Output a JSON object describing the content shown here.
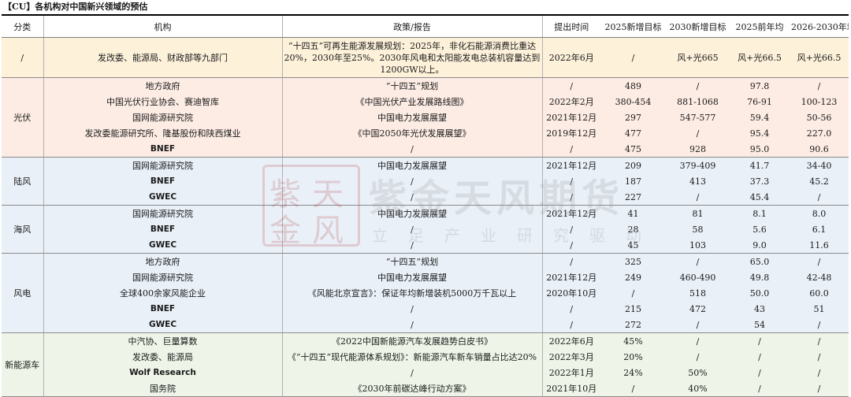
{
  "title": "【CU】各机构对中国新兴领域的预估",
  "headers": [
    "分类",
    "机构",
    "政策/报告",
    "提出时间",
    "2025新增目标",
    "2030新增目标",
    "2025前年均",
    "2026-2030年均"
  ],
  "groups": [
    {
      "category": "/",
      "rows": [
        [
          "发改委、能源局、财政部等九部门",
          "“十四五”可再生能源发展规划：2025年，非化石能源消费比重达20%，2030年至25%。2030年风电和太阳能发电总装机容量达到1200GW以上。",
          "2022年6月",
          "/",
          "风+光665",
          "风+光66.5",
          "风+光66.5"
        ]
      ]
    },
    {
      "category": "光伏",
      "rows": [
        [
          "地方政府",
          "“十四五”规划",
          "/",
          "489",
          "/",
          "97.8",
          "/"
        ],
        [
          "中国光伏行业协会、赛迪智库",
          "《中国光伏产业发展路线图》",
          "2022年2月",
          "380-454",
          "881-1068",
          "76-91",
          "100-123"
        ],
        [
          "国网能源研究院",
          "中国电力发展展望",
          "2021年12月",
          "297",
          "547-577",
          "59.4",
          "50-56"
        ],
        [
          "发改委能源研究所、隆基股份和陕西煤业",
          "《中国2050年光伏发展展望》",
          "2019年12月",
          "477",
          "/",
          "95.4",
          "227.0"
        ],
        [
          "BNEF",
          "/",
          "/",
          "475",
          "928",
          "95.0",
          "90.6"
        ]
      ]
    },
    {
      "category": "陆风",
      "rows": [
        [
          "国网能源研究院",
          "中国电力发展展望",
          "2021年12月",
          "209",
          "379-409",
          "41.7",
          "34-40"
        ],
        [
          "BNEF",
          "/",
          "/",
          "187",
          "413",
          "37.3",
          "45.2"
        ],
        [
          "GWEC",
          "/",
          "/",
          "227",
          "/",
          "45.4",
          "/"
        ]
      ]
    },
    {
      "category": "海风",
      "rows": [
        [
          "国网能源研究院",
          "中国电力发展展望",
          "2021年12月",
          "41",
          "81",
          "8.1",
          "8.0"
        ],
        [
          "BNEF",
          "/",
          "/",
          "28",
          "58",
          "5.6",
          "6.1"
        ],
        [
          "GWEC",
          "/",
          "/",
          "45",
          "103",
          "9.0",
          "11.6"
        ]
      ]
    },
    {
      "category": "风电",
      "rows": [
        [
          "地方政府",
          "“十四五”规划",
          "/",
          "325",
          "/",
          "65.0",
          "/"
        ],
        [
          "国网能源研究院",
          "中国电力发展展望",
          "2021年12月",
          "249",
          "460-490",
          "49.8",
          "42-48"
        ],
        [
          "全球400余家风能企业",
          "《风能北京宣言》：保证年均新增装机5000万千瓦以上",
          "2020年10月",
          "/",
          "518",
          "50.0",
          "60.0"
        ],
        [
          "BNEF",
          "/",
          "/",
          "215",
          "472",
          "43",
          "51"
        ],
        [
          "GWEC",
          "/",
          "/",
          "272",
          "/",
          "54",
          "/"
        ]
      ]
    },
    {
      "category": "新能源车",
      "rows": [
        [
          "中汽协、巨量算数",
          "《2022中国新能源汽车发展趋势白皮书》",
          "2022年6月",
          "45%",
          "/",
          "/",
          "/"
        ],
        [
          "发改委、能源局",
          "《“十四五”现代能源体系规划》：新能源汽车新车销量占比达20%",
          "2022年3月",
          "20%",
          "/",
          "/",
          "/"
        ],
        [
          "Wolf Research",
          "/",
          "2022年1月",
          "24%",
          "50%",
          "/",
          "/"
        ],
        [
          "国务院",
          "《2030年前碳达峰行动方案》",
          "2021年10月",
          "/",
          "40%",
          "/",
          "/"
        ]
      ]
    }
  ],
  "watermark": {
    "seal_chars": [
      "紫",
      "天",
      "金",
      "风"
    ],
    "brand": "紫金天风期货",
    "slogan": "立足产业研究驱动"
  }
}
